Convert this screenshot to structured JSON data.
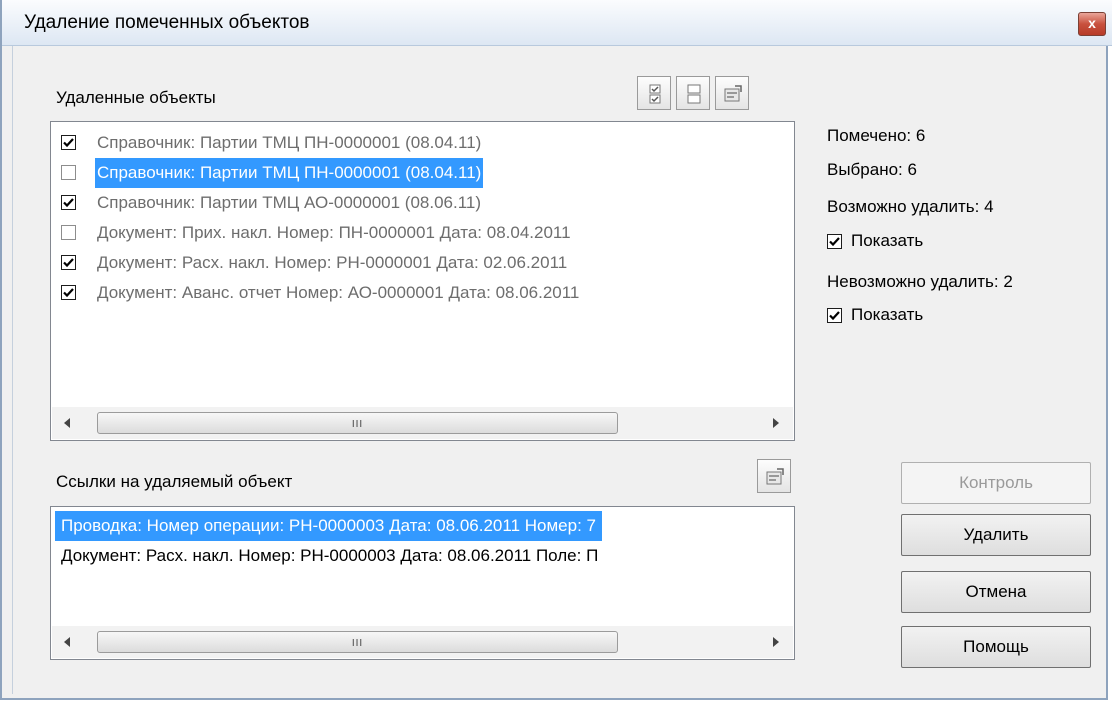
{
  "window": {
    "title": "Удаление помеченных объектов",
    "close_glyph": "x"
  },
  "deleted_objects": {
    "label": "Удаленные объекты",
    "rows": [
      {
        "checked": true,
        "text": "Справочник: Партии ТМЦ  ПН-0000001 (08.04.11)"
      },
      {
        "checked": false,
        "text": "Справочник: Партии ТМЦ  ПН-0000001 (08.04.11)",
        "selected": true
      },
      {
        "checked": true,
        "text": "Справочник: Партии ТМЦ  АО-0000001 (08.06.11)"
      },
      {
        "checked": false,
        "text": "Документ: Прих. накл.  Номер: ПН-0000001  Дата: 08.04.2011"
      },
      {
        "checked": true,
        "text": "Документ: Расх. накл.  Номер: РН-0000001  Дата: 02.06.2011"
      },
      {
        "checked": true,
        "text": "Документ: Аванс. отчет  Номер: АО-0000001  Дата: 08.06.2011"
      }
    ],
    "toolbar_icons": [
      "check-all-icon",
      "uncheck-all-icon",
      "open-object-icon"
    ]
  },
  "references": {
    "label": "Ссылки на удаляемый объект",
    "rows": [
      {
        "text": "Проводка:  Номер операции: РН-0000003  Дата: 08.06.2011 Номер: 7",
        "selected": true
      },
      {
        "text": "Документ: Расх. накл.  Номер: РН-0000003  Дата: 08.06.2011  Поле: П",
        "selected": false
      }
    ]
  },
  "stats": {
    "marked": "Помечено: 6",
    "selected": "Выбрано: 6",
    "can_delete": "Возможно удалить: 4",
    "can_delete_show": "Показать",
    "cannot_delete": "Невозможно удалить: 2",
    "cannot_delete_show": "Показать"
  },
  "buttons": {
    "control": "Контроль",
    "delete": "Удалить",
    "cancel": "Отмена",
    "help": "Помощь"
  },
  "scrollbar_grip": "III"
}
